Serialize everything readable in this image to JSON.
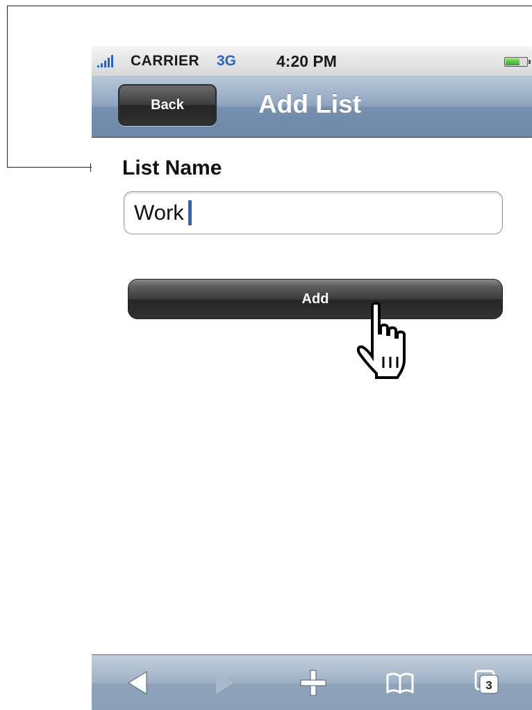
{
  "status_bar": {
    "carrier": "CARRIER",
    "network": "3G",
    "time": "4:20 PM",
    "signal_icon": "signal-bars-icon",
    "battery_icon": "battery-icon"
  },
  "nav_bar": {
    "back_label": "Back",
    "title": "Add List"
  },
  "form": {
    "list_name_label": "List Name",
    "list_name_value": "Work",
    "add_label": "Add"
  },
  "toolbar": {
    "items": [
      "back-arrow-icon",
      "forward-arrow-icon",
      "plus-icon",
      "bookmarks-icon",
      "tabs-icon"
    ],
    "tabs_count": "3"
  },
  "colors": {
    "accent": "#2a64c8",
    "navbar": "#8fa5c0",
    "button_dark": "#3c3c3c"
  }
}
